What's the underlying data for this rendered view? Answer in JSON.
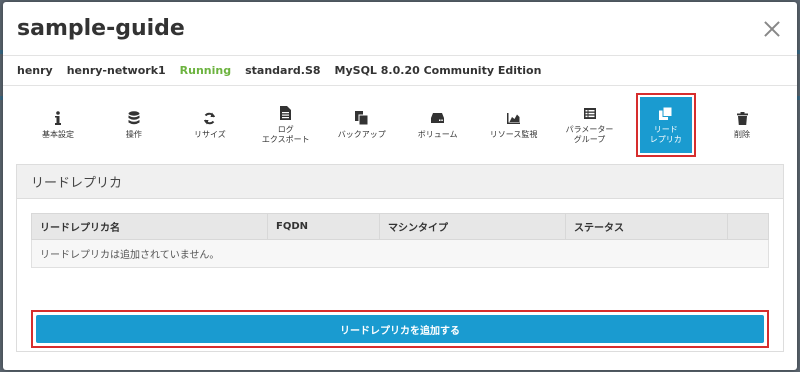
{
  "modal": {
    "title": "sample-guide",
    "close_symbol": ""
  },
  "info": {
    "user": "henry",
    "network": "henry-network1",
    "status": "Running",
    "plan": "standard.S8",
    "engine": "MySQL 8.0.20 Community Edition",
    "status_color": "#6cb33f"
  },
  "toolbar": {
    "items": [
      {
        "label": "基本設定",
        "icon": "info-icon"
      },
      {
        "label": "操作",
        "icon": "database-icon"
      },
      {
        "label": "リサイズ",
        "icon": "refresh-icon"
      },
      {
        "label": "ログ\nエクスポート",
        "icon": "file-icon"
      },
      {
        "label": "バックアップ",
        "icon": "copy-icon"
      },
      {
        "label": "ボリューム",
        "icon": "hdd-icon"
      },
      {
        "label": "リソース監視",
        "icon": "chart-icon"
      },
      {
        "label": "パラメーター\nグループ",
        "icon": "list-icon"
      },
      {
        "label": "リード\nレプリカ",
        "icon": "clone-icon"
      },
      {
        "label": "削除",
        "icon": "trash-icon"
      }
    ],
    "active_color": "#1a9bd0",
    "highlight_color": "#d62d2d"
  },
  "panel": {
    "title": "リードレプリカ",
    "table": {
      "headers": [
        "リードレプリカ名",
        "FQDN",
        "マシンタイプ",
        "ステータス",
        ""
      ],
      "empty_message": "リードレプリカは追加されていません。"
    },
    "add_button": "リードレプリカを追加する"
  }
}
